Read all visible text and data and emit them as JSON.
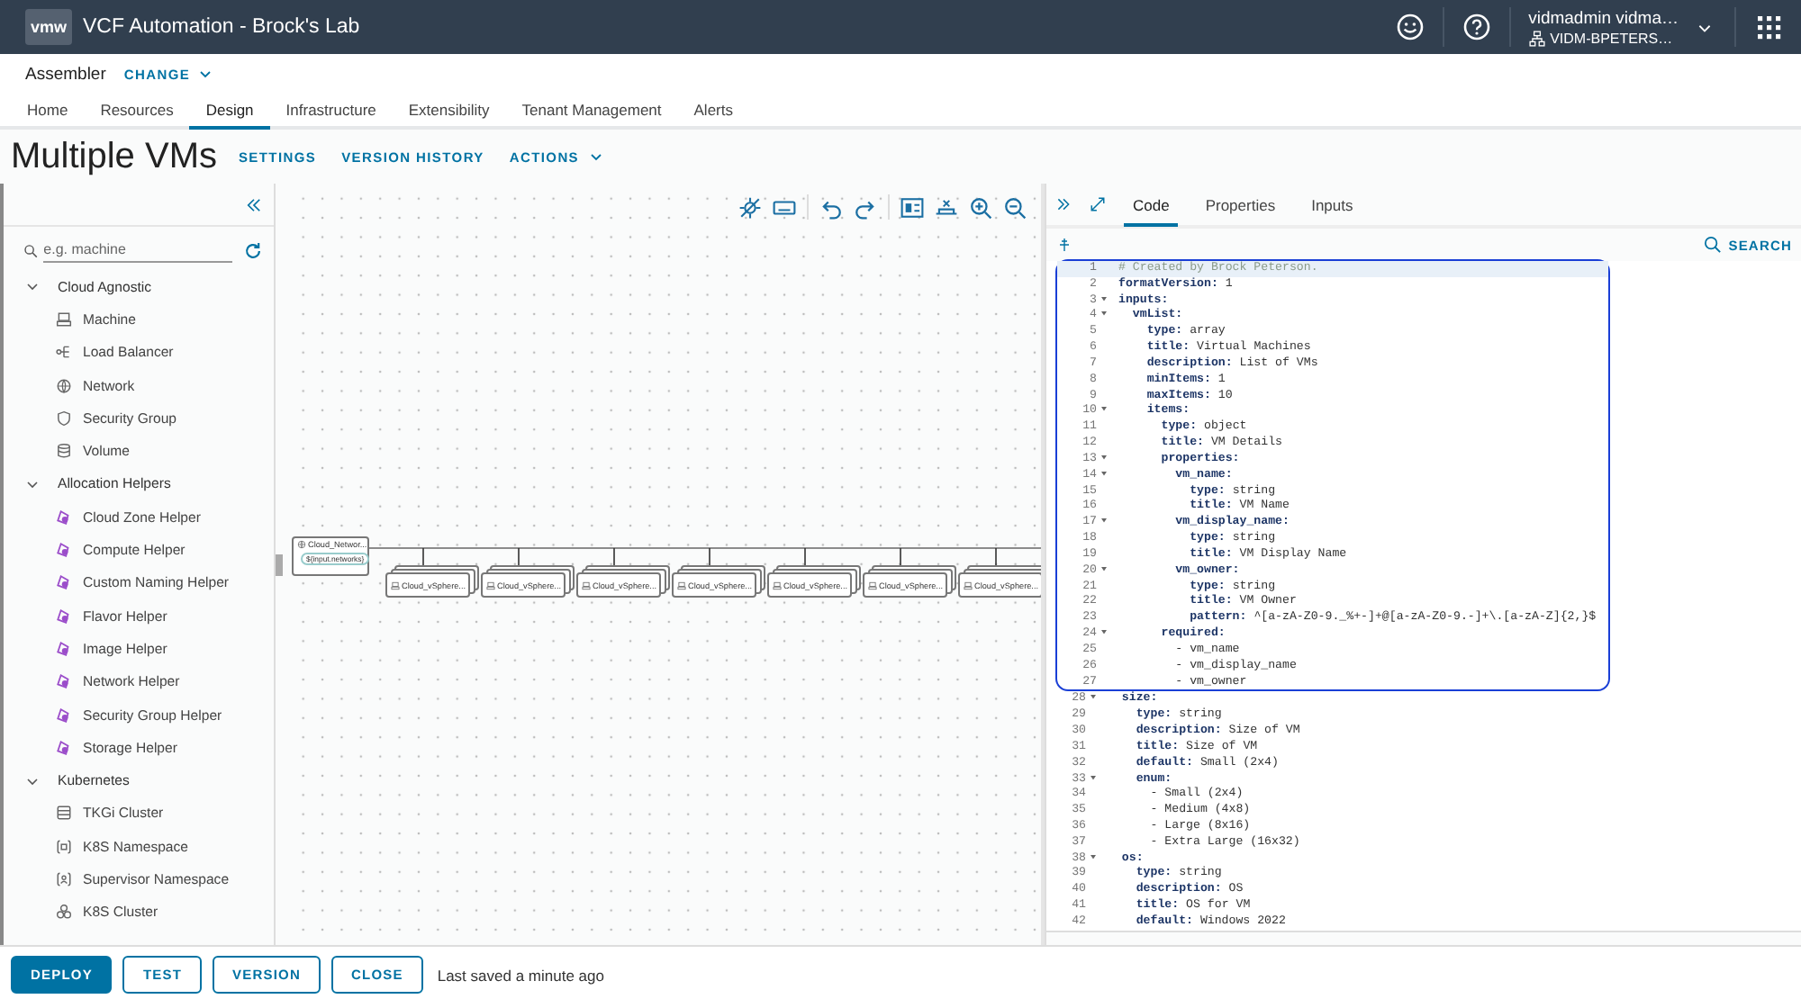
{
  "header": {
    "logo": "vmw",
    "title": "VCF Automation - Brock's Lab",
    "user": {
      "name": "vidmadmin vidma…",
      "org": "VIDM-BPETERS…"
    }
  },
  "app_bar": {
    "app": "Assembler",
    "change": "CHANGE"
  },
  "nav_tabs": [
    {
      "label": "Home",
      "selected": false
    },
    {
      "label": "Resources",
      "selected": false
    },
    {
      "label": "Design",
      "selected": true
    },
    {
      "label": "Infrastructure",
      "selected": false
    },
    {
      "label": "Extensibility",
      "selected": false
    },
    {
      "label": "Tenant Management",
      "selected": false
    },
    {
      "label": "Alerts",
      "selected": false
    }
  ],
  "page": {
    "title": "Multiple VMs",
    "actions": [
      {
        "label": "SETTINGS",
        "kind": "link"
      },
      {
        "label": "VERSION HISTORY",
        "kind": "link"
      },
      {
        "label": "ACTIONS",
        "kind": "menu"
      }
    ]
  },
  "palette": {
    "search": {
      "placeholder": "e.g. machine"
    },
    "groups": [
      {
        "label": "Cloud Agnostic",
        "expanded": true,
        "children": [
          {
            "label": "Machine",
            "kind": "machine"
          },
          {
            "label": "Load Balancer",
            "kind": "load-balancer"
          },
          {
            "label": "Network",
            "kind": "network"
          },
          {
            "label": "Security Group",
            "kind": "security-group"
          },
          {
            "label": "Volume",
            "kind": "volume"
          }
        ]
      },
      {
        "label": "Allocation Helpers",
        "expanded": true,
        "children": [
          {
            "label": "Cloud Zone Helper",
            "kind": "helper"
          },
          {
            "label": "Compute Helper",
            "kind": "helper"
          },
          {
            "label": "Custom Naming Helper",
            "kind": "helper"
          },
          {
            "label": "Flavor Helper",
            "kind": "helper"
          },
          {
            "label": "Image Helper",
            "kind": "helper"
          },
          {
            "label": "Network Helper",
            "kind": "helper"
          },
          {
            "label": "Security Group Helper",
            "kind": "helper"
          },
          {
            "label": "Storage Helper",
            "kind": "helper"
          }
        ]
      },
      {
        "label": "Kubernetes",
        "expanded": true,
        "children": [
          {
            "label": "TKGi Cluster",
            "kind": "cluster"
          },
          {
            "label": "K8S Namespace",
            "kind": "namespace"
          },
          {
            "label": "Supervisor Namespace",
            "kind": "supervisor"
          },
          {
            "label": "K8S Cluster",
            "kind": "k8s-cluster"
          }
        ]
      }
    ]
  },
  "canvas": {
    "network_node": {
      "label": "Cloud_Networ...",
      "binding": "${input.networks}"
    },
    "machine_nodes": [
      {
        "label": "Cloud_vSphere..."
      },
      {
        "label": "Cloud_vSphere..."
      },
      {
        "label": "Cloud_vSphere..."
      },
      {
        "label": "Cloud_vSphere..."
      },
      {
        "label": "Cloud_vSphere..."
      },
      {
        "label": "Cloud_vSphere..."
      },
      {
        "label": "Cloud_vSphere..."
      }
    ]
  },
  "editor": {
    "tabs": [
      {
        "label": "Code",
        "selected": true
      },
      {
        "label": "Properties",
        "selected": false
      },
      {
        "label": "Inputs",
        "selected": false
      }
    ],
    "search": "SEARCH",
    "lines": [
      {
        "number": "1",
        "kind": "comment",
        "key": "# Created by Brock Peterson.",
        "fold": false,
        "active": true,
        "highlighted": true
      },
      {
        "number": "2",
        "kind": "key",
        "key": "formatVersion:",
        "value": " 1",
        "fold": false,
        "active": false,
        "highlighted": true
      },
      {
        "number": "3",
        "kind": "key",
        "key": "inputs:",
        "fold": true,
        "active": false,
        "highlighted": true
      },
      {
        "number": "4",
        "kind": "key",
        "key": "  vmList:",
        "fold": true,
        "active": false,
        "highlighted": true
      },
      {
        "number": "5",
        "kind": "key",
        "key": "    type:",
        "value": " array",
        "fold": false,
        "active": false,
        "highlighted": true
      },
      {
        "number": "6",
        "kind": "key",
        "key": "    title:",
        "value": " Virtual Machines",
        "fold": false,
        "active": false,
        "highlighted": true
      },
      {
        "number": "7",
        "kind": "key",
        "key": "    description:",
        "value": " List of VMs",
        "fold": false,
        "active": false,
        "highlighted": true
      },
      {
        "number": "8",
        "kind": "key",
        "key": "    minItems:",
        "value": " 1",
        "fold": false,
        "active": false,
        "highlighted": true
      },
      {
        "number": "9",
        "kind": "key",
        "key": "    maxItems:",
        "value": " 10",
        "fold": false,
        "active": false,
        "highlighted": true
      },
      {
        "number": "10",
        "kind": "key",
        "key": "    items:",
        "fold": true,
        "active": false,
        "highlighted": true
      },
      {
        "number": "11",
        "kind": "key",
        "key": "      type:",
        "value": " object",
        "fold": false,
        "active": false,
        "highlighted": true
      },
      {
        "number": "12",
        "kind": "key",
        "key": "      title:",
        "value": " VM Details",
        "fold": false,
        "active": false,
        "highlighted": true
      },
      {
        "number": "13",
        "kind": "key",
        "key": "      properties:",
        "fold": true,
        "active": false,
        "highlighted": true
      },
      {
        "number": "14",
        "kind": "key",
        "key": "        vm_name:",
        "fold": true,
        "active": false,
        "highlighted": true
      },
      {
        "number": "15",
        "kind": "key",
        "key": "          type:",
        "value": " string",
        "fold": false,
        "active": false,
        "highlighted": true
      },
      {
        "number": "16",
        "kind": "key",
        "key": "          title:",
        "value": " VM Name",
        "fold": false,
        "active": false,
        "highlighted": true
      },
      {
        "number": "17",
        "kind": "key",
        "key": "        vm_display_name:",
        "fold": true,
        "active": false,
        "highlighted": true
      },
      {
        "number": "18",
        "kind": "key",
        "key": "          type:",
        "value": " string",
        "fold": false,
        "active": false,
        "highlighted": true
      },
      {
        "number": "19",
        "kind": "key",
        "key": "          title:",
        "value": " VM Display Name",
        "fold": false,
        "active": false,
        "highlighted": true
      },
      {
        "number": "20",
        "kind": "key",
        "key": "        vm_owner:",
        "fold": true,
        "active": false,
        "highlighted": true
      },
      {
        "number": "21",
        "kind": "key",
        "key": "          type:",
        "value": " string",
        "fold": false,
        "active": false,
        "highlighted": true
      },
      {
        "number": "22",
        "kind": "key",
        "key": "          title:",
        "value": " VM Owner",
        "fold": false,
        "active": false,
        "highlighted": true
      },
      {
        "number": "23",
        "kind": "key",
        "key": "          pattern:",
        "value": " ^[a-zA-Z0-9._%+-]+@[a-zA-Z0-9.-]+\\.[a-zA-Z]{2,}$",
        "fold": false,
        "active": false,
        "highlighted": true
      },
      {
        "number": "24",
        "kind": "key",
        "key": "      required:",
        "fold": true,
        "active": false,
        "highlighted": true
      },
      {
        "number": "25",
        "kind": "item",
        "key": "        - vm_name",
        "fold": false,
        "active": false,
        "highlighted": true
      },
      {
        "number": "26",
        "kind": "item",
        "key": "        - vm_display_name",
        "fold": false,
        "active": false,
        "highlighted": true
      },
      {
        "number": "27",
        "kind": "item",
        "key": "        - vm_owner",
        "fold": false,
        "active": false,
        "highlighted": true
      },
      {
        "number": "28",
        "kind": "key",
        "key": "  size:",
        "fold": true,
        "active": false,
        "highlighted": false
      },
      {
        "number": "29",
        "kind": "key",
        "key": "    type:",
        "value": " string",
        "fold": false,
        "active": false,
        "highlighted": false
      },
      {
        "number": "30",
        "kind": "key",
        "key": "    description:",
        "value": " Size of VM",
        "fold": false,
        "active": false,
        "highlighted": false
      },
      {
        "number": "31",
        "kind": "key",
        "key": "    title:",
        "value": " Size of VM",
        "fold": false,
        "active": false,
        "highlighted": false
      },
      {
        "number": "32",
        "kind": "key",
        "key": "    default:",
        "value": " Small (2x4)",
        "fold": false,
        "active": false,
        "highlighted": false
      },
      {
        "number": "33",
        "kind": "key",
        "key": "    enum:",
        "fold": true,
        "active": false,
        "highlighted": false
      },
      {
        "number": "34",
        "kind": "item",
        "key": "      - Small (2x4)",
        "fold": false,
        "active": false,
        "highlighted": false
      },
      {
        "number": "35",
        "kind": "item",
        "key": "      - Medium (4x8)",
        "fold": false,
        "active": false,
        "highlighted": false
      },
      {
        "number": "36",
        "kind": "item",
        "key": "      - Large (8x16)",
        "fold": false,
        "active": false,
        "highlighted": false
      },
      {
        "number": "37",
        "kind": "item",
        "key": "      - Extra Large (16x32)",
        "fold": false,
        "active": false,
        "highlighted": false
      },
      {
        "number": "38",
        "kind": "key",
        "key": "  os:",
        "fold": true,
        "active": false,
        "highlighted": false
      },
      {
        "number": "39",
        "kind": "key",
        "key": "    type:",
        "value": " string",
        "fold": false,
        "active": false,
        "highlighted": false
      },
      {
        "number": "40",
        "kind": "key",
        "key": "    description:",
        "value": " OS",
        "fold": false,
        "active": false,
        "highlighted": false
      },
      {
        "number": "41",
        "kind": "key",
        "key": "    title:",
        "value": " OS for VM",
        "fold": false,
        "active": false,
        "highlighted": false
      },
      {
        "number": "42",
        "kind": "key",
        "key": "    default:",
        "value": " Windows 2022",
        "fold": false,
        "active": false,
        "highlighted": false
      }
    ]
  },
  "footer": {
    "buttons": [
      {
        "label": "DEPLOY",
        "kind": "primary"
      },
      {
        "label": "TEST",
        "kind": "outline"
      },
      {
        "label": "VERSION",
        "kind": "outline"
      },
      {
        "label": "CLOSE",
        "kind": "outline"
      }
    ],
    "status": "Last saved a minute ago"
  }
}
